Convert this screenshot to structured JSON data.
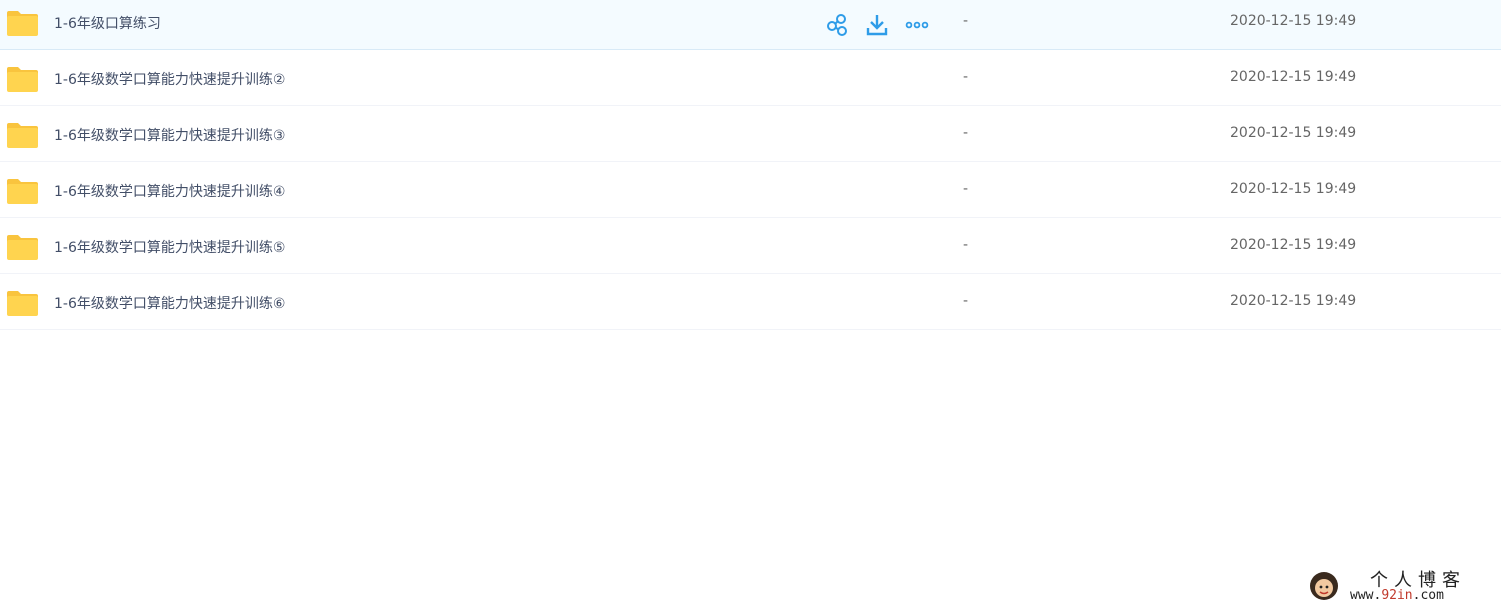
{
  "colors": {
    "folder": "#ffd44f",
    "folder_tab": "#f9c43e",
    "action_icon": "#2e9ce8",
    "hover_row_bg": "#f4fbff"
  },
  "files": [
    {
      "name": "1-6年级口算练习",
      "size": "-",
      "modified": "2020-12-15 19:49",
      "icon": "folder-icon"
    },
    {
      "name": "1-6年级数学口算能力快速提升训练②",
      "size": "-",
      "modified": "2020-12-15 19:49",
      "icon": "folder-icon"
    },
    {
      "name": "1-6年级数学口算能力快速提升训练③",
      "size": "-",
      "modified": "2020-12-15 19:49",
      "icon": "folder-icon"
    },
    {
      "name": "1-6年级数学口算能力快速提升训练④",
      "size": "-",
      "modified": "2020-12-15 19:49",
      "icon": "folder-icon"
    },
    {
      "name": "1-6年级数学口算能力快速提升训练⑤",
      "size": "-",
      "modified": "2020-12-15 19:49",
      "icon": "folder-icon"
    },
    {
      "name": "1-6年级数学口算能力快速提升训练⑥",
      "size": "-",
      "modified": "2020-12-15 19:49",
      "icon": "folder-icon"
    }
  ],
  "row_actions": [
    {
      "icon": "share-icon"
    },
    {
      "icon": "download-icon"
    },
    {
      "icon": "more-icon"
    }
  ],
  "watermark": {
    "title": "个人博客",
    "url_prefix": "www.",
    "url_accent": "92in",
    "url_suffix": ".com"
  }
}
